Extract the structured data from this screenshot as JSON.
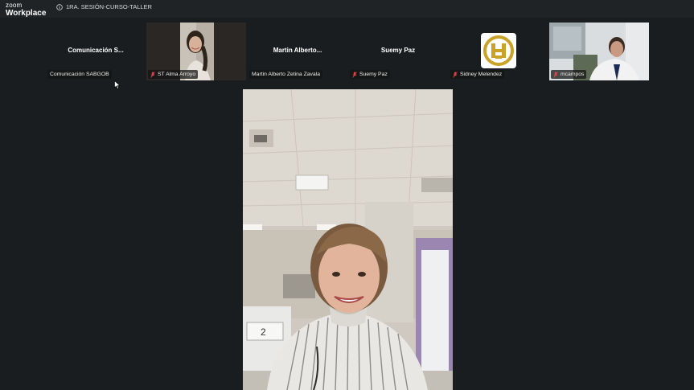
{
  "app": {
    "brand_line1": "zoom",
    "brand_line2": "Workplace",
    "meeting_title": "1RA. SESIÓN-CURSO-TALLER"
  },
  "participants": [
    {
      "display_name": "Comunicación  S...",
      "label": "Comunicación SABGOB",
      "muted": false,
      "has_video": false
    },
    {
      "display_name": "",
      "label": "ST Alma Arroyo",
      "muted": true,
      "has_video": true
    },
    {
      "display_name": "Martin  Alberto...",
      "label": "Martin Alberto Zetina Zavala",
      "muted": false,
      "has_video": false
    },
    {
      "display_name": "Suemy Paz",
      "label": "Suemy Paz",
      "muted": true,
      "has_video": false
    },
    {
      "display_name": "",
      "label": "Sidney Melendez",
      "muted": true,
      "has_video": false,
      "avatar": "logo"
    },
    {
      "display_name": "",
      "label": "mcampos",
      "muted": true,
      "has_video": true
    }
  ],
  "colors": {
    "background": "#1a1d1f",
    "titlebar": "#202326",
    "muted_icon": "#e0454f",
    "logo_gold": "#c9a227"
  },
  "icons": {
    "info": "info-icon",
    "mic_muted": "mic-muted-icon",
    "cursor": "cursor-icon"
  }
}
